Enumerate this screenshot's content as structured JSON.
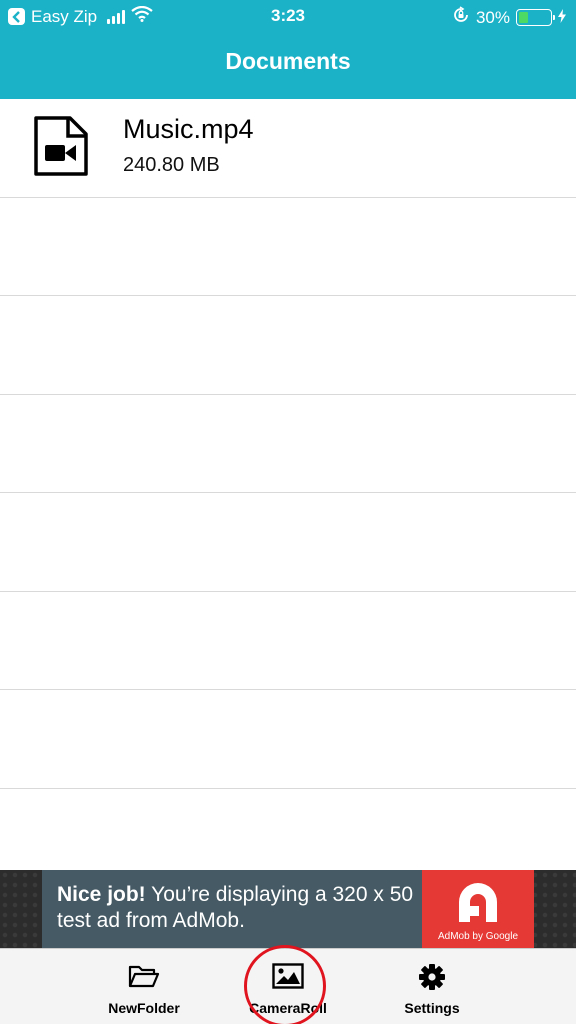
{
  "status_bar": {
    "back_app": "Easy Zip",
    "time": "3:23",
    "battery_percent": "30%",
    "battery_level": 0.3
  },
  "nav": {
    "title": "Documents"
  },
  "files": [
    {
      "name": "Music.mp4",
      "size": "240.80 MB",
      "icon": "video-file-icon"
    }
  ],
  "ad": {
    "headline": "Nice job!",
    "body": " You’re displaying a 320 x 50 test ad from AdMob.",
    "logo_caption": "AdMob by Google"
  },
  "tabbar": {
    "items": [
      {
        "label": "NewFolder",
        "icon": "folder-open-icon"
      },
      {
        "label": "CameraRoll",
        "icon": "image-icon"
      },
      {
        "label": "Settings",
        "icon": "gear-icon"
      }
    ]
  },
  "colors": {
    "header": "#1bb2c8",
    "ad_background": "#455a64",
    "ad_logo": "#e53935",
    "highlight": "#e0141e"
  }
}
